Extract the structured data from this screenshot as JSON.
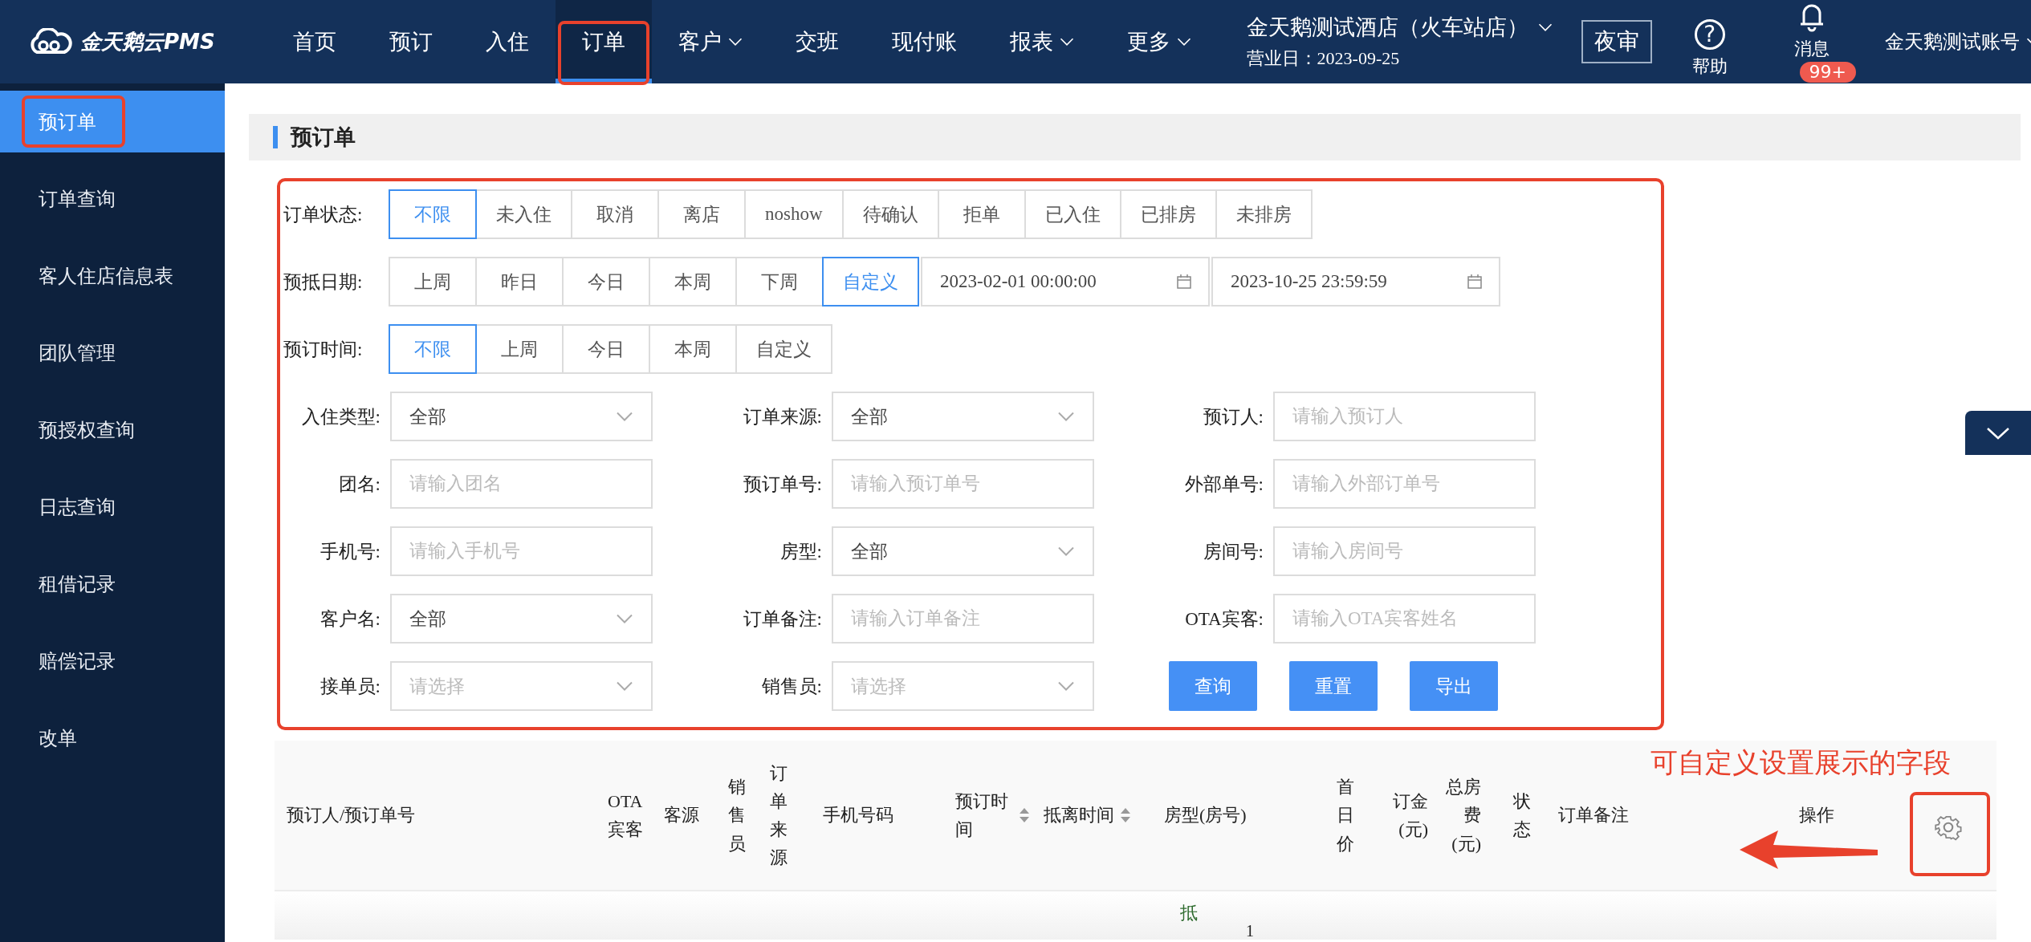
{
  "app": {
    "logo": "金天鹅云PMS"
  },
  "nav": [
    {
      "label": "首页",
      "selected": false,
      "dropdown": false,
      "highlighted": false
    },
    {
      "label": "预订",
      "selected": false,
      "dropdown": false,
      "highlighted": false
    },
    {
      "label": "入住",
      "selected": false,
      "dropdown": false,
      "highlighted": false
    },
    {
      "label": "订单",
      "selected": true,
      "dropdown": false,
      "highlighted": true
    },
    {
      "label": "客户",
      "selected": false,
      "dropdown": true,
      "highlighted": false
    },
    {
      "label": "交班",
      "selected": false,
      "dropdown": false,
      "highlighted": false
    },
    {
      "label": "现付账",
      "selected": false,
      "dropdown": false,
      "highlighted": false
    },
    {
      "label": "报表",
      "selected": false,
      "dropdown": true,
      "highlighted": false
    },
    {
      "label": "更多",
      "selected": false,
      "dropdown": true,
      "highlighted": false
    }
  ],
  "hotel": {
    "name": "金天鹅测试酒店（火车站店）",
    "business_day": "营业日：2023-09-25"
  },
  "night_audit_button": "夜审",
  "help": {
    "icon": "?",
    "label": "帮助"
  },
  "messages": {
    "label": "消息",
    "badge": "99+"
  },
  "account": "金天鹅测试账号",
  "sidebar": [
    {
      "label": "预订单",
      "selected": true,
      "highlighted": true
    },
    {
      "label": "订单查询",
      "selected": false,
      "highlighted": false
    },
    {
      "label": "客人住店信息表",
      "selected": false,
      "highlighted": false
    },
    {
      "label": "团队管理",
      "selected": false,
      "highlighted": false
    },
    {
      "label": "预授权查询",
      "selected": false,
      "highlighted": false
    },
    {
      "label": "日志查询",
      "selected": false,
      "highlighted": false
    },
    {
      "label": "租借记录",
      "selected": false,
      "highlighted": false
    },
    {
      "label": "赔偿记录",
      "selected": false,
      "highlighted": false
    },
    {
      "label": "改单",
      "selected": false,
      "highlighted": false
    }
  ],
  "page_title": "预订单",
  "filters": {
    "highlighted": true,
    "segment_rows": [
      {
        "label": "订单状态:",
        "options": [
          {
            "label": "不限",
            "selected": true
          },
          {
            "label": "未入住",
            "selected": false
          },
          {
            "label": "取消",
            "selected": false
          },
          {
            "label": "离店",
            "selected": false
          },
          {
            "label": "noshow",
            "selected": false
          },
          {
            "label": "待确认",
            "selected": false
          },
          {
            "label": "拒单",
            "selected": false
          },
          {
            "label": "已入住",
            "selected": false
          },
          {
            "label": "已排房",
            "selected": false
          },
          {
            "label": "未排房",
            "selected": false
          }
        ]
      },
      {
        "label": "预抵日期:",
        "options": [
          {
            "label": "上周",
            "selected": false
          },
          {
            "label": "昨日",
            "selected": false
          },
          {
            "label": "今日",
            "selected": false
          },
          {
            "label": "本周",
            "selected": false
          },
          {
            "label": "下周",
            "selected": false
          },
          {
            "label": "自定义",
            "selected": true
          }
        ],
        "date_fields": [
          "2023-02-01 00:00:00",
          "2023-10-25 23:59:59"
        ]
      },
      {
        "label": "预订时间:",
        "options": [
          {
            "label": "不限",
            "selected": true
          },
          {
            "label": "上周",
            "selected": false
          },
          {
            "label": "今日",
            "selected": false
          },
          {
            "label": "本周",
            "selected": false
          },
          {
            "label": "自定义",
            "selected": false
          }
        ]
      }
    ],
    "fields": [
      {
        "label": "入住类型:",
        "kind": "select",
        "value": "全部"
      },
      {
        "label": "订单来源:",
        "kind": "select",
        "value": "全部"
      },
      {
        "label": "预订人:",
        "kind": "input",
        "placeholder": "请输入预订人"
      },
      {
        "label": "团名:",
        "kind": "input",
        "placeholder": "请输入团名"
      },
      {
        "label": "预订单号:",
        "kind": "input",
        "placeholder": "请输入预订单号"
      },
      {
        "label": "外部单号:",
        "kind": "input",
        "placeholder": "请输入外部订单号"
      },
      {
        "label": "手机号:",
        "kind": "input",
        "placeholder": "请输入手机号"
      },
      {
        "label": "房型:",
        "kind": "select",
        "value": "全部"
      },
      {
        "label": "房间号:",
        "kind": "input",
        "placeholder": "请输入房间号"
      },
      {
        "label": "客户名:",
        "kind": "select",
        "value": "全部"
      },
      {
        "label": "订单备注:",
        "kind": "input",
        "placeholder": "请输入订单备注"
      },
      {
        "label": "OTA宾客:",
        "kind": "input",
        "placeholder": "请输入OTA宾客姓名"
      },
      {
        "label": "接单员:",
        "kind": "select",
        "placeholder": "请选择"
      },
      {
        "label": "销售员:",
        "kind": "select",
        "placeholder": "请选择"
      }
    ],
    "actions": [
      "查询",
      "重置",
      "导出"
    ]
  },
  "table": {
    "columns": [
      {
        "label": "预订人/预订单号",
        "sortable": false
      },
      {
        "label": "OTA宾客",
        "sortable": false
      },
      {
        "label": "客源",
        "sortable": false
      },
      {
        "label": "销售员",
        "sortable": false
      },
      {
        "label": "订单来源",
        "sortable": false
      },
      {
        "label": "手机号码",
        "sortable": false
      },
      {
        "label": "预订时间",
        "sortable": true
      },
      {
        "label": "抵离时间",
        "sortable": true
      },
      {
        "label": "房型(房号)",
        "sortable": false
      },
      {
        "label": "首日价",
        "sortable": false
      },
      {
        "label": "订金(元)",
        "sortable": false
      },
      {
        "label": "总房费(元)",
        "sortable": false
      },
      {
        "label": "状态",
        "sortable": false
      },
      {
        "label": "订单备注",
        "sortable": false
      },
      {
        "label": "操作",
        "sortable": false
      }
    ],
    "settings_highlighted": true,
    "partial_row": {
      "tag": "抵",
      "count": "1"
    }
  },
  "annotation": {
    "text": "可自定义设置展示的字段"
  }
}
